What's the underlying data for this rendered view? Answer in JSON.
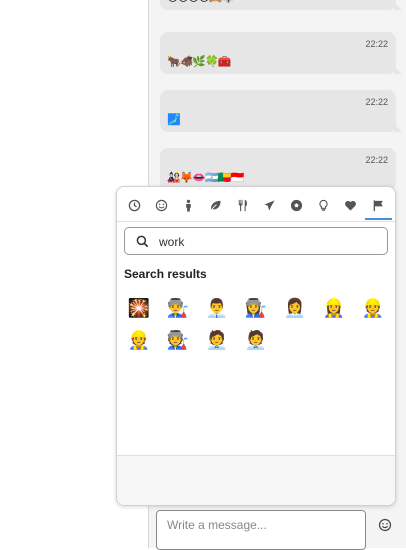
{
  "chat": {
    "messages": [
      {
        "time": "",
        "content": "😍😊😯😡🙈🐺"
      },
      {
        "time": "22:22",
        "content": "🐂🐗🌿🍀🧰"
      },
      {
        "time": "22:22",
        "content": "🗾"
      },
      {
        "time": "22:22",
        "content": "🎎🦊👄🇦🇷🇧🇯🇮🇩"
      }
    ]
  },
  "composer": {
    "placeholder": "Write a message...",
    "emoji_button_icon": "smiley-icon"
  },
  "emoji_picker": {
    "categories": [
      {
        "name": "recent",
        "icon": "clock-icon"
      },
      {
        "name": "smileys",
        "icon": "smiley-icon"
      },
      {
        "name": "people",
        "icon": "person-icon"
      },
      {
        "name": "nature",
        "icon": "leaf-icon"
      },
      {
        "name": "food",
        "icon": "cutlery-icon"
      },
      {
        "name": "travel",
        "icon": "airplane-icon"
      },
      {
        "name": "activities",
        "icon": "soccer-icon"
      },
      {
        "name": "objects",
        "icon": "lightbulb-icon"
      },
      {
        "name": "symbols",
        "icon": "heart-icon"
      },
      {
        "name": "flags",
        "icon": "flag-icon",
        "active": true
      }
    ],
    "search": {
      "value": "work",
      "icon": "search-icon"
    },
    "results_title": "Search results",
    "results": [
      "🎇",
      "👨‍🏭",
      "👨‍💼",
      "👩‍🏭",
      "👩‍💼",
      "👷‍♀️",
      "👷",
      "👷",
      "🧑‍🏭",
      "🧑‍💼",
      "🧑‍💼"
    ]
  },
  "colors": {
    "accent": "#4a90d9",
    "bubble": "#e6e6e6",
    "chat_background": "#f4f4f4"
  }
}
